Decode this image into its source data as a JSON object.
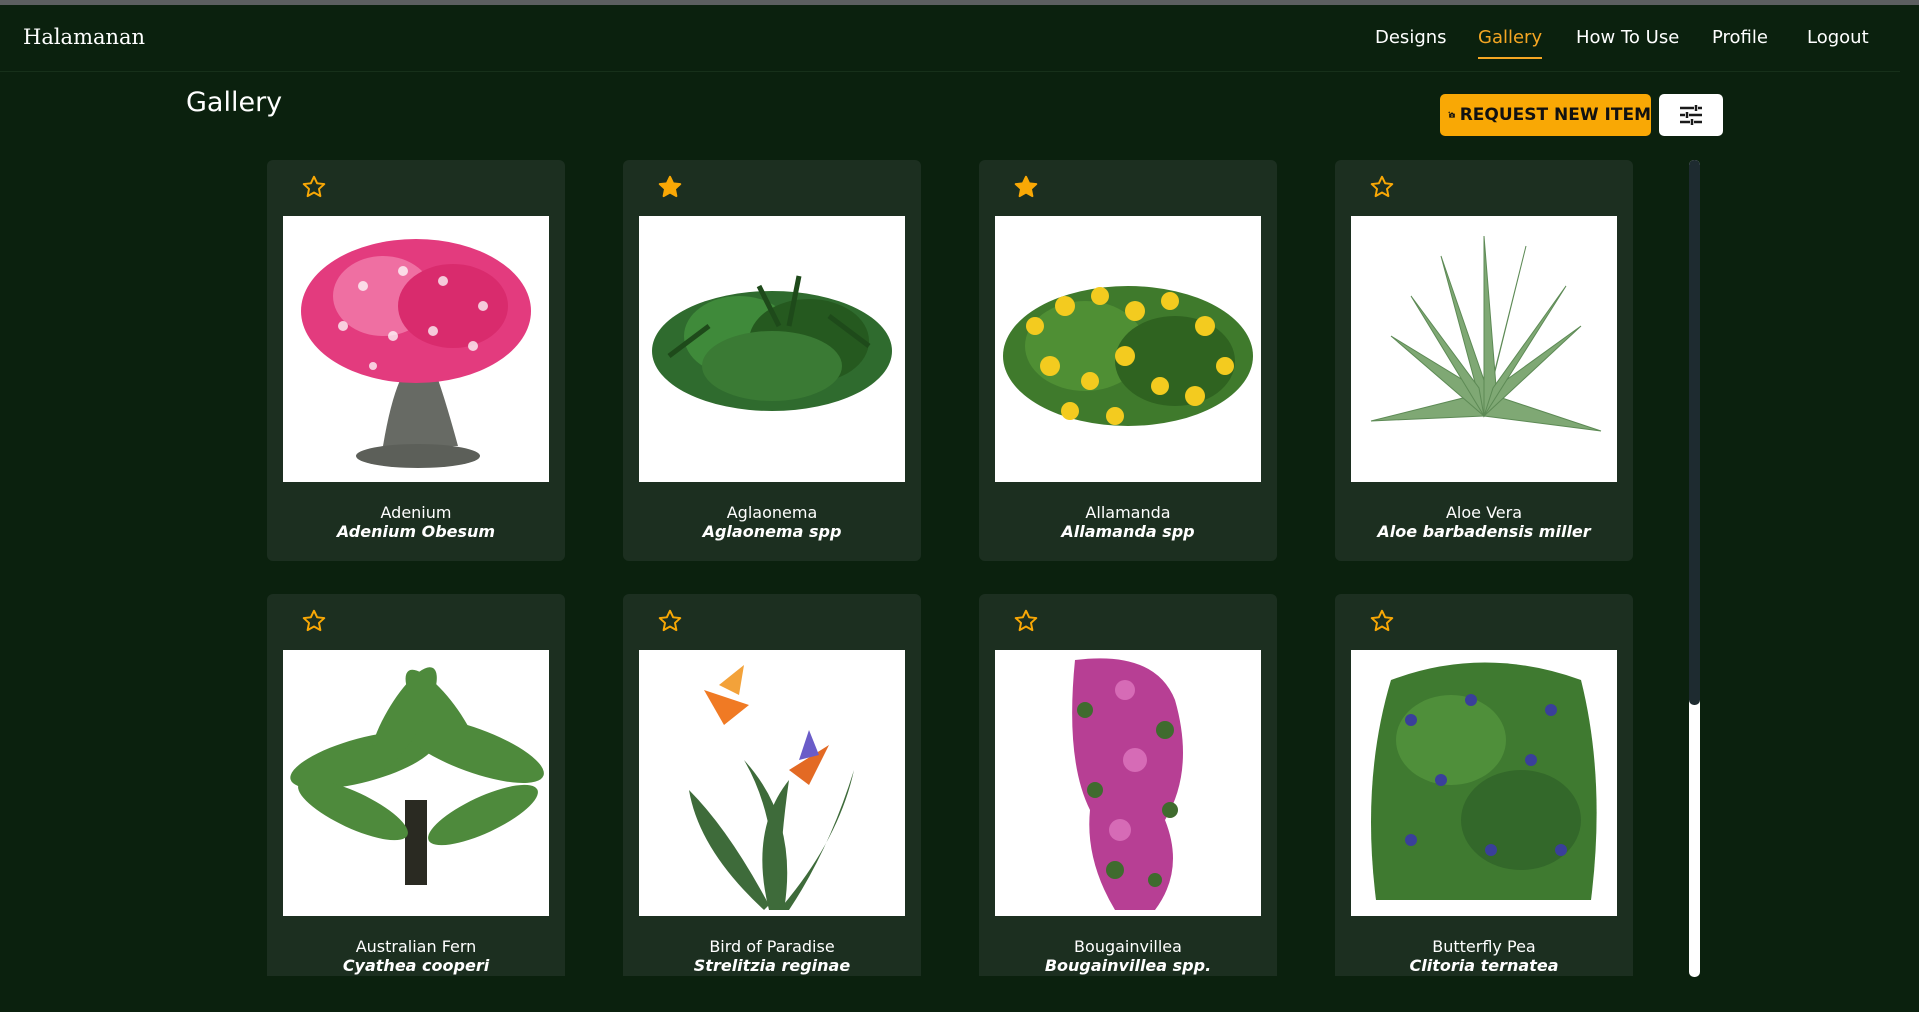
{
  "app": {
    "brand": "Halamanan"
  },
  "nav": {
    "items": [
      {
        "label": "Designs",
        "active": false
      },
      {
        "label": "Gallery",
        "active": true
      },
      {
        "label": "How To Use",
        "active": false
      },
      {
        "label": "Profile",
        "active": false
      },
      {
        "label": "Logout",
        "active": false
      }
    ]
  },
  "page": {
    "title": "Gallery",
    "request_button": "REQUEST NEW ITEM",
    "filter_icon": "sliders-icon"
  },
  "colors": {
    "background": "#0b210e",
    "card": "#1c2f20",
    "accent": "#f9a805",
    "active_nav": "#f5a623"
  },
  "plants": [
    {
      "name": "Adenium",
      "scientific": "Adenium Obesum",
      "favorite": false,
      "icon": "adenium-image"
    },
    {
      "name": "Aglaonema",
      "scientific": "Aglaonema spp",
      "favorite": true,
      "icon": "aglaonema-image"
    },
    {
      "name": "Allamanda",
      "scientific": "Allamanda spp",
      "favorite": true,
      "icon": "allamanda-image"
    },
    {
      "name": "Aloe Vera",
      "scientific": "Aloe barbadensis miller",
      "favorite": false,
      "icon": "aloe-vera-image"
    },
    {
      "name": "Australian Fern",
      "scientific": "Cyathea cooperi",
      "favorite": false,
      "icon": "australian-fern-image"
    },
    {
      "name": "Bird of Paradise",
      "scientific": "Strelitzia reginae",
      "favorite": false,
      "icon": "bird-of-paradise-image"
    },
    {
      "name": "Bougainvillea",
      "scientific": "Bougainvillea spp.",
      "favorite": false,
      "icon": "bougainvillea-image"
    },
    {
      "name": "Butterfly Pea",
      "scientific": "Clitoria ternatea",
      "favorite": false,
      "icon": "butterfly-pea-image"
    }
  ]
}
